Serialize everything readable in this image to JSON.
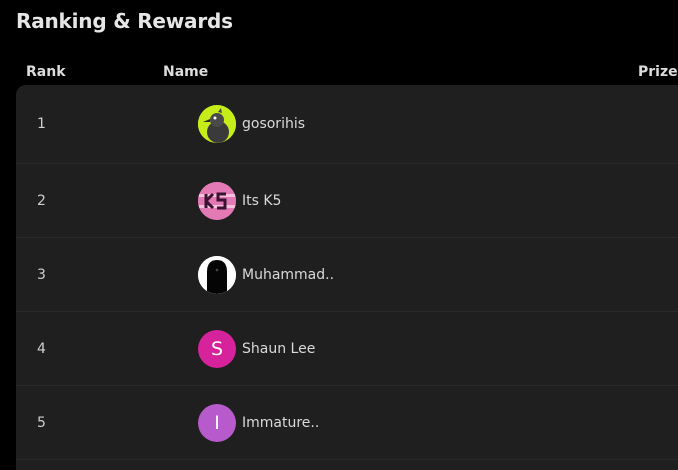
{
  "header": {
    "title": "Ranking & Rewards"
  },
  "columns": {
    "rank": "Rank",
    "name": "Name",
    "prize": "Prize"
  },
  "rows": [
    {
      "rank": "1",
      "name": "gosorihis",
      "avatar": "crow-avatar-icon"
    },
    {
      "rank": "2",
      "name": "Its K5",
      "avatar": "k5-logo-avatar-icon"
    },
    {
      "rank": "3",
      "name": "Muhammad..",
      "avatar": "person-photo-avatar-icon"
    },
    {
      "rank": "4",
      "name": "Shaun Lee",
      "avatar_initial": "S",
      "avatar_color": "#d6239b"
    },
    {
      "rank": "5",
      "name": "Immature..",
      "avatar_initial": "I",
      "avatar_color": "#b75acb"
    }
  ],
  "colors": {
    "background": "#000000",
    "table_background": "#1f1f1f",
    "header_text": "#dcdcdc"
  }
}
